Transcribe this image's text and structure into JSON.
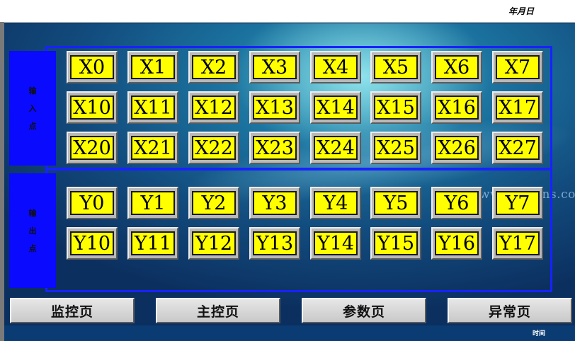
{
  "header": {
    "date_label": "年月日"
  },
  "inputs": {
    "title_chars": [
      "输",
      "入",
      "点"
    ],
    "rows": [
      [
        "X0",
        "X1",
        "X2",
        "X3",
        "X4",
        "X5",
        "X6",
        "X7"
      ],
      [
        "X10",
        "X11",
        "X12",
        "X13",
        "X14",
        "X15",
        "X16",
        "X17"
      ],
      [
        "X20",
        "X21",
        "X22",
        "X23",
        "X24",
        "X25",
        "X26",
        "X27"
      ]
    ]
  },
  "outputs": {
    "title_chars": [
      "输",
      "出",
      "点"
    ],
    "rows": [
      [
        "Y0",
        "Y1",
        "Y2",
        "Y3",
        "Y4",
        "Y5",
        "Y6",
        "Y7"
      ],
      [
        "Y10",
        "Y11",
        "Y12",
        "Y13",
        "Y14",
        "Y15",
        "Y16",
        "Y17"
      ]
    ]
  },
  "watermark": "www.elecfans.com",
  "nav": [
    "监控页",
    "主控页",
    "参数页",
    "异常页"
  ],
  "footer": {
    "time_label": "时间"
  },
  "colors": {
    "lamp": "#ffff00",
    "frame": "#1822ff",
    "label_panel": "#0a0aff"
  }
}
